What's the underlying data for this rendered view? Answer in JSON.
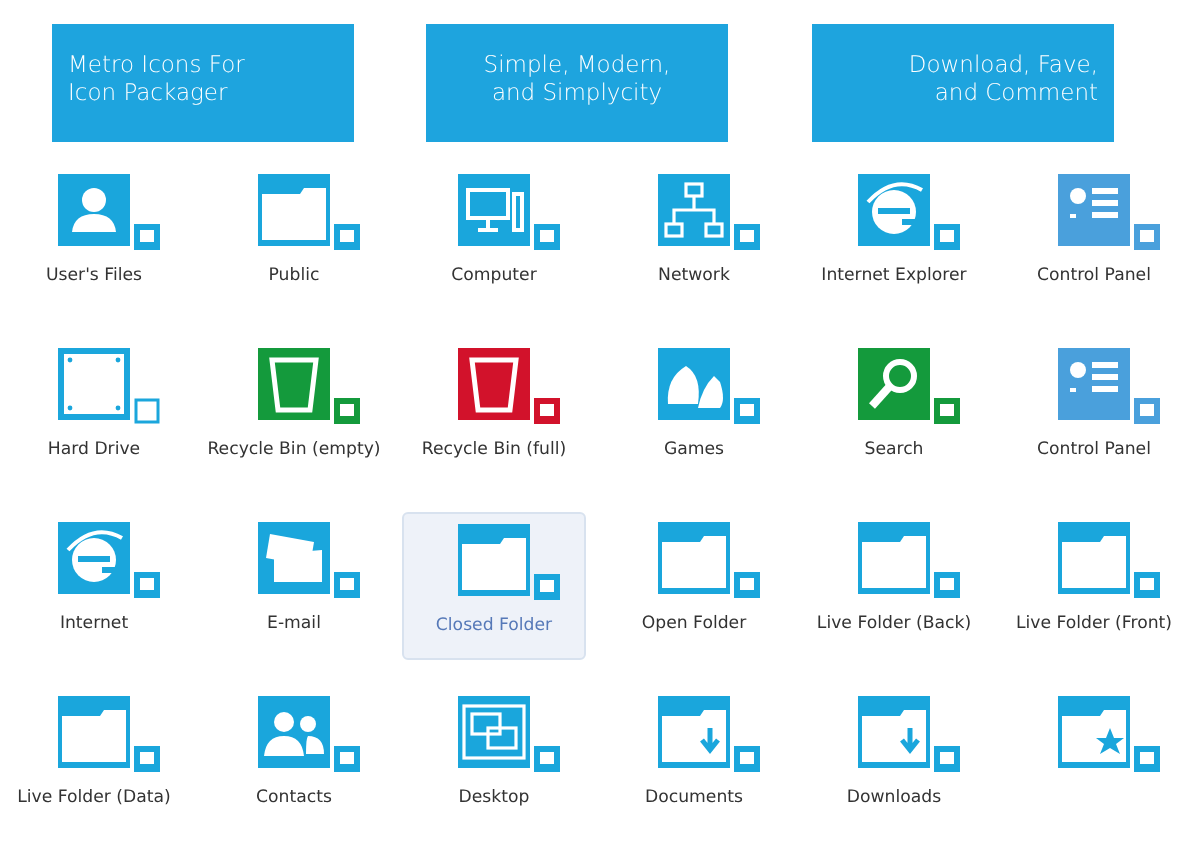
{
  "banners": [
    {
      "lines": [
        "Metro Icons For",
        "Icon Packager"
      ]
    },
    {
      "lines": [
        "Simple, Modern,",
        "and Simplycity"
      ]
    },
    {
      "lines": [
        "Download, Fave,",
        "and Comment"
      ]
    }
  ],
  "icons": [
    {
      "kind": "user",
      "label": "User's Files",
      "selected": false
    },
    {
      "kind": "folder",
      "label": "Public",
      "selected": false
    },
    {
      "kind": "computer",
      "label": "Computer",
      "selected": false
    },
    {
      "kind": "network",
      "label": "Network",
      "selected": false
    },
    {
      "kind": "browser",
      "label": "Internet Explorer",
      "selected": false
    },
    {
      "kind": "panel",
      "label": "Control Panel",
      "selected": false
    },
    {
      "kind": "drive",
      "label": "Hard Drive",
      "selected": false
    },
    {
      "kind": "bin",
      "label": "Recycle Bin (empty)",
      "selected": false
    },
    {
      "kind": "binfull",
      "label": "Recycle Bin (full)",
      "selected": false
    },
    {
      "kind": "games",
      "label": "Games",
      "selected": false
    },
    {
      "kind": "search",
      "label": "Search",
      "selected": false
    },
    {
      "kind": "panel",
      "label": "Control Panel",
      "selected": false
    },
    {
      "kind": "browser",
      "label": "Internet",
      "selected": false
    },
    {
      "kind": "mail",
      "label": "E-mail",
      "selected": false
    },
    {
      "kind": "folder",
      "label": "Closed Folder",
      "selected": true
    },
    {
      "kind": "folder",
      "label": "Open Folder",
      "selected": false
    },
    {
      "kind": "folder",
      "label": "Live Folder (Back)",
      "selected": false
    },
    {
      "kind": "folder",
      "label": "Live Folder (Front)",
      "selected": false
    },
    {
      "kind": "folder",
      "label": "Live Folder (Data)",
      "selected": false
    },
    {
      "kind": "contacts",
      "label": "Contacts",
      "selected": false
    },
    {
      "kind": "desktop",
      "label": "Desktop",
      "selected": false
    },
    {
      "kind": "download",
      "label": "Documents",
      "selected": false
    },
    {
      "kind": "download",
      "label": "Downloads",
      "selected": false
    },
    {
      "kind": "star",
      "selected": false
    }
  ]
}
